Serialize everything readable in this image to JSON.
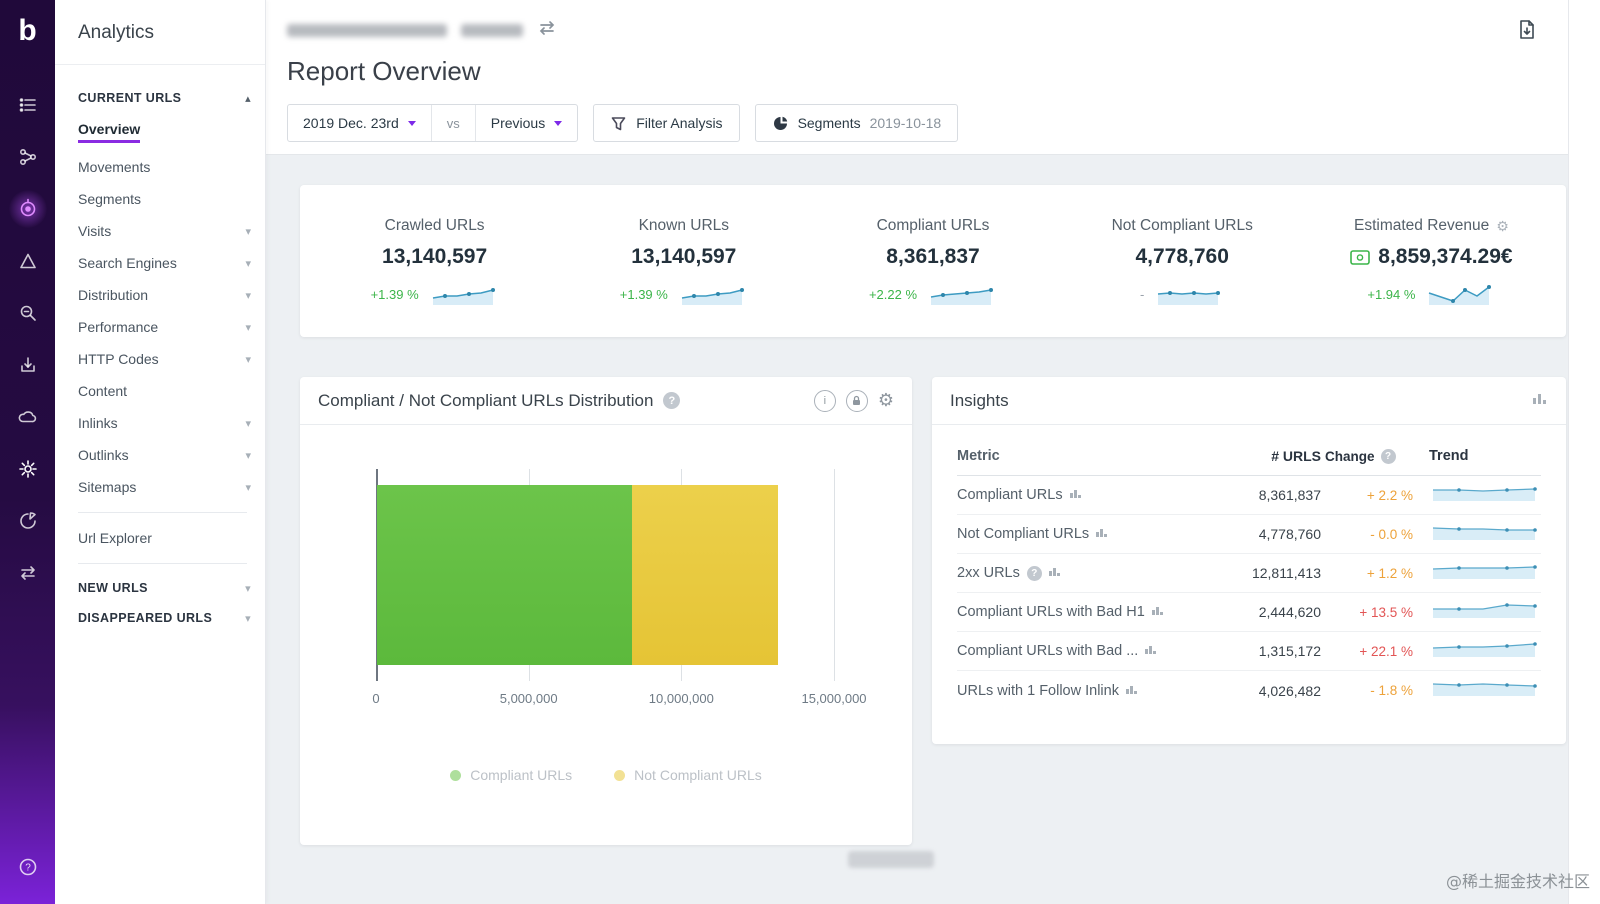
{
  "watermark": "@稀土掘金技术社区",
  "colors": {
    "accent_purple": "#8a2be2",
    "compliant_green": "#6cc44a",
    "not_compliant_yellow": "#e8c83d",
    "spark_blue": "#3d9bc2",
    "positive_green": "#3cb54a",
    "change_orange": "#eda23a",
    "change_red": "#e25555"
  },
  "rail": {
    "logo_letter": "b"
  },
  "sidebar": {
    "title": "Analytics",
    "section_current": "CURRENT URLS",
    "items": [
      {
        "label": "Overview"
      },
      {
        "label": "Movements"
      },
      {
        "label": "Segments"
      },
      {
        "label": "Visits"
      },
      {
        "label": "Search Engines"
      },
      {
        "label": "Distribution"
      },
      {
        "label": "Performance"
      },
      {
        "label": "HTTP Codes"
      },
      {
        "label": "Content"
      },
      {
        "label": "Inlinks"
      },
      {
        "label": "Outlinks"
      },
      {
        "label": "Sitemaps"
      },
      {
        "label": "Url Explorer"
      }
    ],
    "section_new": "NEW URLS",
    "section_disappeared": "DISAPPEARED URLS"
  },
  "header": {
    "title": "Report Overview",
    "date_button": "2019 Dec. 23rd",
    "vs_label": "vs",
    "compare_button": "Previous",
    "filter_button": "Filter Analysis",
    "segments_button": "Segments",
    "segments_date": "2019-10-18"
  },
  "kpis": [
    {
      "label": "Crawled URLs",
      "value": "13,140,597",
      "change": "+1.39 %"
    },
    {
      "label": "Known URLs",
      "value": "13,140,597",
      "change": "+1.39 %"
    },
    {
      "label": "Compliant URLs",
      "value": "8,361,837",
      "change": "+2.22 %"
    },
    {
      "label": "Not Compliant URLs",
      "value": "4,778,760",
      "change": "-"
    },
    {
      "label": "Estimated Revenue",
      "value": "8,859,374.29€",
      "change": "+1.94 %"
    }
  ],
  "chart_data": {
    "type": "bar",
    "orientation": "horizontal",
    "stacked": true,
    "title": "Compliant / Not Compliant URLs Distribution",
    "series": [
      {
        "name": "Compliant URLs",
        "value": 8361837,
        "color": "#6cc44a"
      },
      {
        "name": "Not Compliant URLs",
        "value": 4778760,
        "color": "#e8c83d"
      }
    ],
    "xlim": [
      0,
      15000000
    ],
    "x_ticks": [
      "0",
      "5,000,000",
      "10,000,000",
      "15,000,000"
    ],
    "grid": true,
    "legend_position": "bottom"
  },
  "insights": {
    "title": "Insights",
    "columns": [
      "Metric",
      "# URLS",
      "Change",
      "Trend"
    ],
    "rows": [
      {
        "metric": "Compliant URLs",
        "urls": "8,361,837",
        "change": "+ 2.2 %"
      },
      {
        "metric": "Not Compliant URLs",
        "urls": "4,778,760",
        "change": "- 0.0 %"
      },
      {
        "metric": "2xx URLs",
        "urls": "12,811,413",
        "change": "+ 1.2 %"
      },
      {
        "metric": "Compliant URLs with Bad H1",
        "urls": "2,444,620",
        "change": "+ 13.5 %"
      },
      {
        "metric": "Compliant URLs with Bad ...",
        "urls": "1,315,172",
        "change": "+ 22.1 %"
      },
      {
        "metric": "URLs with 1 Follow Inlink",
        "urls": "4,026,482",
        "change": "- 1.8 %"
      }
    ]
  }
}
